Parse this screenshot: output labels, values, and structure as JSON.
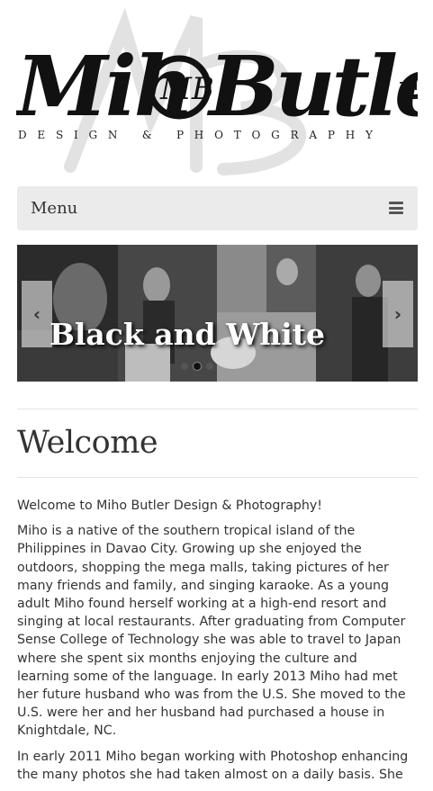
{
  "header": {
    "logo_name": "MihoButler",
    "logo_tm": "TM",
    "logo_subtitle": "DESIGN & PHOTOGRAPHY"
  },
  "nav": {
    "menu_label": "Menu",
    "menu_icon": "hamburger-icon"
  },
  "slider": {
    "caption": "Black and White",
    "prev_icon": "chevron-left-icon",
    "next_icon": "chevron-right-icon",
    "dot_count": 3,
    "active_dot": 2
  },
  "page": {
    "title": "Welcome",
    "paragraphs": [
      "Welcome to Miho Butler Design & Photography!",
      "Miho is a native of the southern tropical island of the Philippines in Davao City. Growing up she enjoyed the outdoors, shopping the mega malls, taking pictures of her many friends and family, and singing karaoke. As a young adult Miho found herself working at a high-end resort and singing at local restaurants. After graduating from Computer Sense College of Technology she was able to travel to Japan where she spent six months enjoying the culture and learning some of the language. In early 2013 Miho had met her future husband who was from the U.S. She moved to the U.S. were her and her husband had purchased a house in Knightdale, NC.",
      "In early 2011 Miho began working with Photoshop enhancing the many photos she had taken almost on a daily basis. She"
    ]
  }
}
